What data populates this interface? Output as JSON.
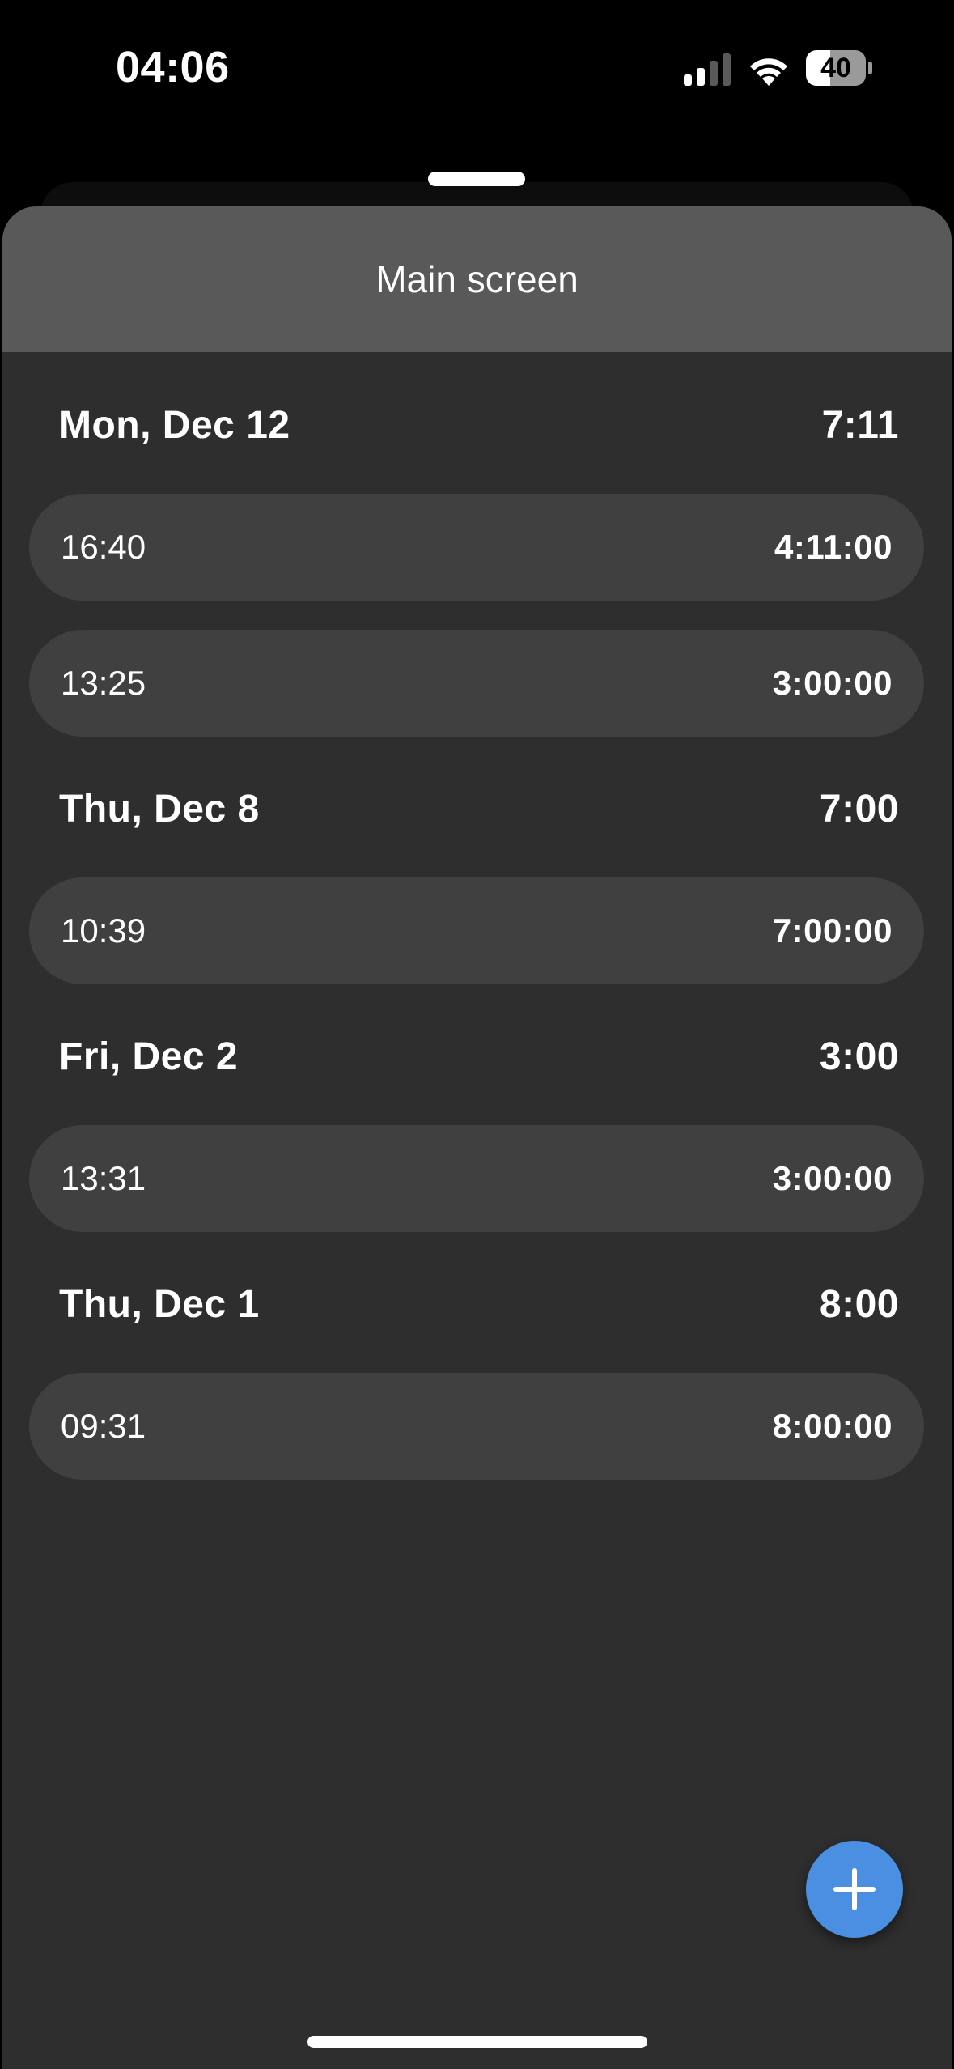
{
  "status_bar": {
    "time": "04:06",
    "battery_level": "40",
    "battery_fraction": 0.4,
    "signal_icon": "cellular-signal-icon",
    "wifi_icon": "wifi-icon"
  },
  "header": {
    "title": "Main screen"
  },
  "sections": [
    {
      "date": "Mon, Dec 12",
      "total": "7:11",
      "entries": [
        {
          "start": "16:40",
          "duration": "4:11:00"
        },
        {
          "start": "13:25",
          "duration": "3:00:00"
        }
      ]
    },
    {
      "date": "Thu, Dec 8",
      "total": "7:00",
      "entries": [
        {
          "start": "10:39",
          "duration": "7:00:00"
        }
      ]
    },
    {
      "date": "Fri, Dec 2",
      "total": "3:00",
      "entries": [
        {
          "start": "13:31",
          "duration": "3:00:00"
        }
      ]
    },
    {
      "date": "Thu, Dec 1",
      "total": "8:00",
      "entries": [
        {
          "start": "09:31",
          "duration": "8:00:00"
        }
      ]
    }
  ],
  "fab": {
    "icon": "plus-icon"
  },
  "colors": {
    "background": "#000000",
    "sheet": "#2e2e2e",
    "nav_bar": "#595959",
    "entry": "#404040",
    "accent": "#4a8fe2"
  }
}
